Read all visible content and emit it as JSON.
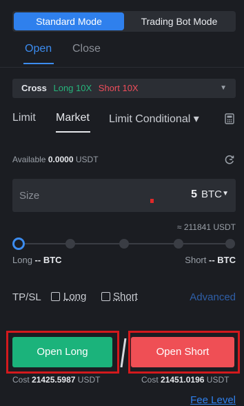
{
  "mode_toggle": {
    "standard_label": "Standard Mode",
    "bot_label": "Trading Bot Mode"
  },
  "tabs": {
    "open_label": "Open",
    "close_label": "Close"
  },
  "leverage": {
    "margin_mode": "Cross",
    "long_label": "Long 10X",
    "short_label": "Short 10X",
    "caret": "▼"
  },
  "order_types": {
    "limit": "Limit",
    "market": "Market",
    "limit_conditional": "Limit Conditional ▾"
  },
  "available": {
    "label": "Available",
    "value": "0.0000",
    "unit": "USDT"
  },
  "size": {
    "label": "Size",
    "value": "5",
    "unit": "BTC",
    "caret": "▼"
  },
  "approx_value": "≈ 211841 USDT",
  "slider": {
    "percent": 0
  },
  "position": {
    "long_label": "Long",
    "long_value": "-- BTC",
    "short_label": "Short",
    "short_value": "-- BTC"
  },
  "tpsl": {
    "label": "TP/SL",
    "long_label": "Long",
    "short_label": "Short",
    "advanced_label": "Advanced"
  },
  "buttons": {
    "open_long": "Open Long",
    "open_short": "Open Short"
  },
  "cost": {
    "long_label": "Cost",
    "long_value": "21425.5987",
    "long_unit": "USDT",
    "short_label": "Cost",
    "short_value": "21451.0196",
    "short_unit": "USDT"
  },
  "fee_level_label": "Fee Level",
  "colors": {
    "accent": "#2f80ed",
    "long": "#1bb37b",
    "short": "#ef4f55",
    "highlight_frame": "#d3191d"
  }
}
